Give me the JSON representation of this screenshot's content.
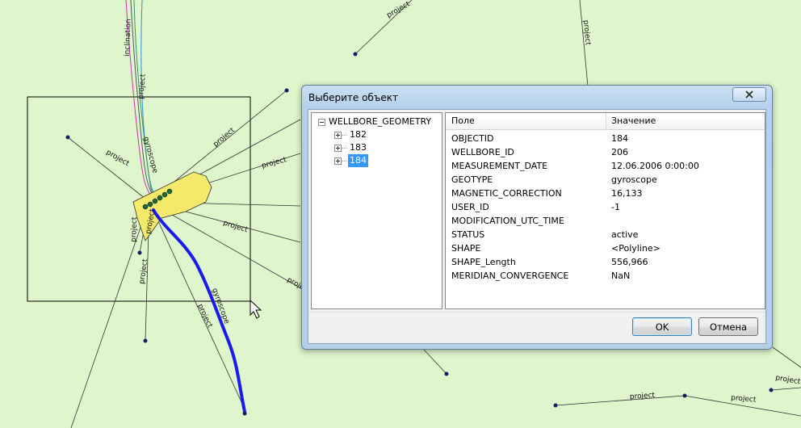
{
  "map": {
    "labels": [
      "project",
      "inclination",
      "project",
      "gyroscope",
      "project",
      "project",
      "project",
      "project",
      "project",
      "gyroscope",
      "project",
      "project",
      "project",
      "project",
      "project",
      "project",
      "project",
      "project"
    ]
  },
  "dialog": {
    "title": "Выберите объект",
    "close_icon": "close-x-icon",
    "tree": {
      "root": "WELLBORE_GEOMETRY",
      "children": [
        "182",
        "183",
        "184"
      ],
      "selected": "184"
    },
    "grid": {
      "headers": [
        "Поле",
        "Значение"
      ],
      "rows": [
        {
          "field": "OBJECTID",
          "value": "184"
        },
        {
          "field": "WELLBORE_ID",
          "value": "206"
        },
        {
          "field": "MEASUREMENT_DATE",
          "value": "12.06.2006 0:00:00"
        },
        {
          "field": "GEOTYPE",
          "value": "gyroscope"
        },
        {
          "field": "MAGNETIC_CORRECTION",
          "value": "16,133"
        },
        {
          "field": "USER_ID",
          "value": "-1"
        },
        {
          "field": "MODIFICATION_UTC_TIME",
          "value": ""
        },
        {
          "field": "STATUS",
          "value": "active"
        },
        {
          "field": "SHAPE",
          "value": "<Polyline>"
        },
        {
          "field": "SHAPE_Length",
          "value": "556,966"
        },
        {
          "field": "MERIDIAN_CONVERGENCE",
          "value": "NaN"
        }
      ]
    },
    "ok_label": "OK",
    "cancel_label": "Отмена"
  }
}
